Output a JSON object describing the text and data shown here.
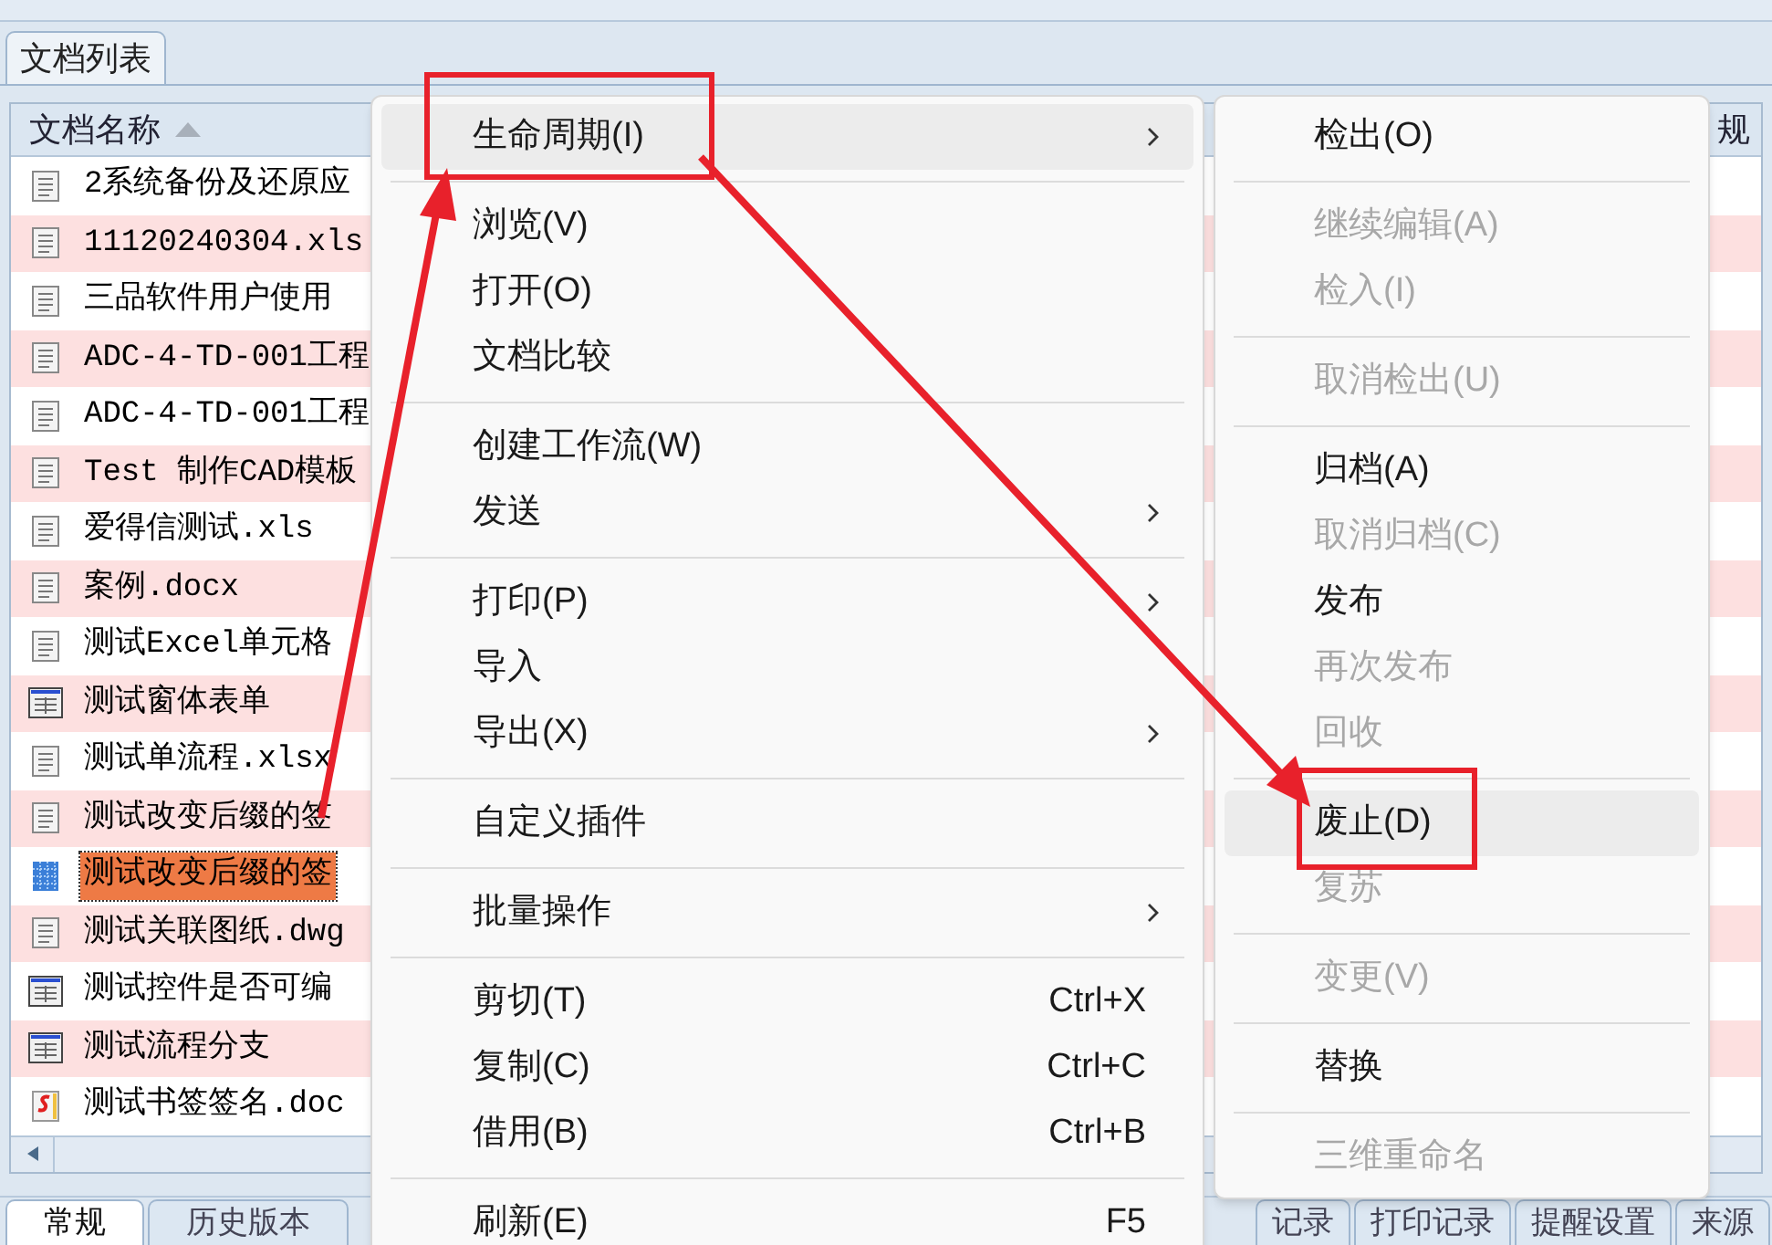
{
  "panel_tab": {
    "label": "文档列表",
    "selected": true
  },
  "table": {
    "columns": [
      {
        "label": "文档名称",
        "sorted": true
      },
      {
        "label": "规"
      }
    ],
    "rows": [
      {
        "name": "2系统备份及还原应",
        "kind": "doc",
        "selected": false
      },
      {
        "name": "11120240304.xls",
        "kind": "doc",
        "selected": false
      },
      {
        "name": "三品软件用户使用",
        "kind": "doc",
        "selected": false
      },
      {
        "name": "ADC-4-TD-001工程",
        "kind": "doc",
        "selected": false
      },
      {
        "name": "ADC-4-TD-001工程",
        "kind": "doc",
        "selected": false
      },
      {
        "name": "Test 制作CAD模板",
        "kind": "doc",
        "selected": false
      },
      {
        "name": "爱得信测试.xls",
        "kind": "doc",
        "selected": false
      },
      {
        "name": "案例.docx",
        "kind": "doc",
        "selected": false
      },
      {
        "name": "测试Excel单元格",
        "kind": "doc",
        "selected": false
      },
      {
        "name": "测试窗体表单",
        "kind": "form",
        "selected": false
      },
      {
        "name": "测试单流程.xlsx",
        "kind": "doc",
        "selected": false
      },
      {
        "name": "测试改变后缀的签",
        "kind": "doc",
        "selected": false
      },
      {
        "name": "测试改变后缀的签",
        "kind": "grid",
        "selected": true
      },
      {
        "name": "测试关联图纸.dwg",
        "kind": "doc",
        "selected": false
      },
      {
        "name": "测试控件是否可编",
        "kind": "form",
        "selected": false
      },
      {
        "name": "测试流程分支",
        "kind": "form",
        "selected": false
      },
      {
        "name": "测试书签签名.doc",
        "kind": "sign",
        "selected": false
      }
    ]
  },
  "bottom_tabs_left": [
    {
      "label": "常规",
      "selected": true
    },
    {
      "label": "历史版本",
      "selected": false
    }
  ],
  "bottom_tabs_right": [
    {
      "label": "记录",
      "selected": false
    },
    {
      "label": "打印记录",
      "selected": false
    },
    {
      "label": "提醒设置",
      "selected": false
    },
    {
      "label": "来源",
      "selected": false
    }
  ],
  "context_menu": [
    {
      "kind": "item",
      "label": "生命周期(I)",
      "submenu": true,
      "selected": true
    },
    {
      "kind": "separator"
    },
    {
      "kind": "item",
      "label": "浏览(V)",
      "submenu": false,
      "selected": false
    },
    {
      "kind": "item",
      "label": "打开(O)",
      "submenu": false,
      "selected": false
    },
    {
      "kind": "item",
      "label": "文档比较",
      "submenu": false,
      "selected": false
    },
    {
      "kind": "separator"
    },
    {
      "kind": "item",
      "label": "创建工作流(W)",
      "submenu": false,
      "selected": false
    },
    {
      "kind": "item",
      "label": "发送",
      "submenu": true,
      "selected": false
    },
    {
      "kind": "separator"
    },
    {
      "kind": "item",
      "label": "打印(P)",
      "submenu": true,
      "selected": false
    },
    {
      "kind": "item",
      "label": "导入",
      "submenu": false,
      "selected": false
    },
    {
      "kind": "item",
      "label": "导出(X)",
      "submenu": true,
      "selected": false
    },
    {
      "kind": "separator"
    },
    {
      "kind": "item",
      "label": "自定义插件",
      "submenu": false,
      "selected": false
    },
    {
      "kind": "separator"
    },
    {
      "kind": "item",
      "label": "批量操作",
      "submenu": true,
      "selected": false
    },
    {
      "kind": "separator"
    },
    {
      "kind": "item",
      "label": "剪切(T)",
      "shortcut": "Ctrl+X",
      "submenu": false,
      "selected": false
    },
    {
      "kind": "item",
      "label": "复制(C)",
      "shortcut": "Ctrl+C",
      "submenu": false,
      "selected": false
    },
    {
      "kind": "item",
      "label": "借用(B)",
      "shortcut": "Ctrl+B",
      "submenu": false,
      "selected": false
    },
    {
      "kind": "separator"
    },
    {
      "kind": "item",
      "label": "刷新(E)",
      "shortcut": "F5",
      "submenu": false,
      "selected": false
    }
  ],
  "submenu": [
    {
      "kind": "item",
      "label": "检出(O)",
      "disabled": false,
      "selected": false
    },
    {
      "kind": "separator"
    },
    {
      "kind": "item",
      "label": "继续编辑(A)",
      "disabled": true,
      "selected": false
    },
    {
      "kind": "item",
      "label": "检入(I)",
      "disabled": true,
      "selected": false
    },
    {
      "kind": "separator"
    },
    {
      "kind": "item",
      "label": "取消检出(U)",
      "disabled": true,
      "selected": false
    },
    {
      "kind": "separator"
    },
    {
      "kind": "item",
      "label": "归档(A)",
      "disabled": false,
      "selected": false
    },
    {
      "kind": "item",
      "label": "取消归档(C)",
      "disabled": true,
      "selected": false
    },
    {
      "kind": "item",
      "label": "发布",
      "disabled": false,
      "selected": false
    },
    {
      "kind": "item",
      "label": "再次发布",
      "disabled": true,
      "selected": false
    },
    {
      "kind": "item",
      "label": "回收",
      "disabled": true,
      "selected": false
    },
    {
      "kind": "separator"
    },
    {
      "kind": "item",
      "label": "废止(D)",
      "disabled": false,
      "selected": true
    },
    {
      "kind": "item",
      "label": "复苏",
      "disabled": true,
      "selected": false
    },
    {
      "kind": "separator"
    },
    {
      "kind": "item",
      "label": "变更(V)",
      "disabled": true,
      "selected": false
    },
    {
      "kind": "separator"
    },
    {
      "kind": "item",
      "label": "替换",
      "disabled": false,
      "selected": false
    },
    {
      "kind": "separator"
    },
    {
      "kind": "item",
      "label": "三维重命名",
      "disabled": true,
      "selected": false
    }
  ]
}
